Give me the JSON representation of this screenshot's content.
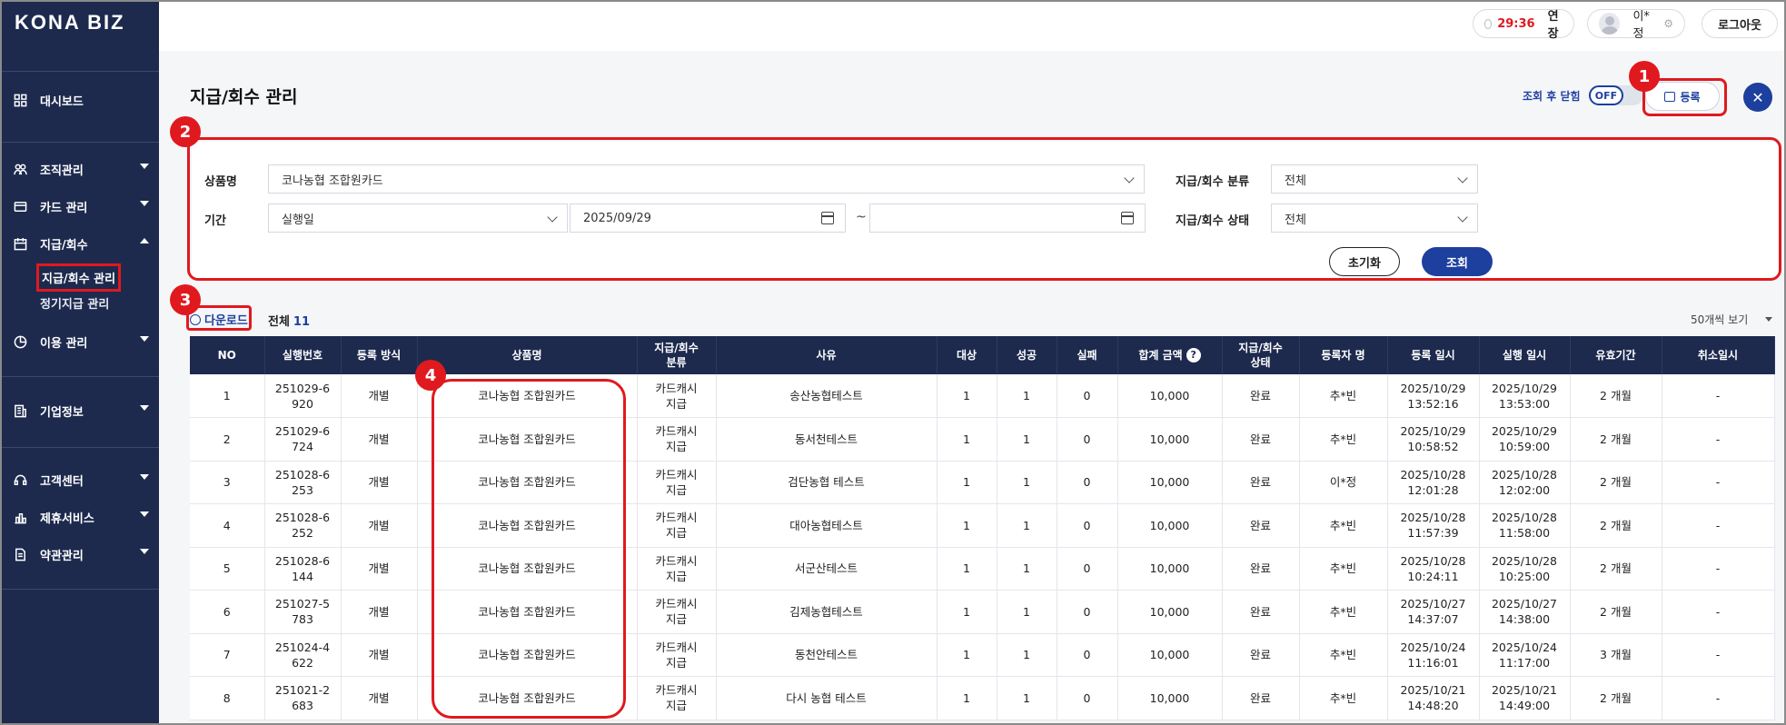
{
  "app": {
    "logo": "KONA BIZ"
  },
  "sidebar": {
    "items": [
      {
        "label": "대시보드",
        "icon": "dashboard-icon"
      },
      {
        "label": "조직관리",
        "icon": "people-icon"
      },
      {
        "label": "카드 관리",
        "icon": "card-icon"
      },
      {
        "label": "지급/회수",
        "icon": "calendar-icon"
      },
      {
        "label": "이용 관리",
        "icon": "pie-icon"
      },
      {
        "label": "기업정보",
        "icon": "building-icon"
      },
      {
        "label": "고객센터",
        "icon": "headset-icon"
      },
      {
        "label": "제휴서비스",
        "icon": "partner-icon"
      },
      {
        "label": "약관관리",
        "icon": "document-icon"
      }
    ],
    "sub": [
      {
        "label": "지급/회수 관리"
      },
      {
        "label": "정기지급 관리"
      }
    ]
  },
  "topbar": {
    "timer": "29:36",
    "extend": "연장",
    "user": "이*정",
    "logout": "로그아웃"
  },
  "page": {
    "title": "지급/회수 관리",
    "close_after_label": "조회 후 닫힘",
    "toggle": "OFF",
    "register": "등록"
  },
  "annotations": [
    "1",
    "2",
    "3",
    "4"
  ],
  "filter": {
    "product_label": "상품명",
    "product_value": "코나농협 조합원카드",
    "category_label": "지급/회수 분류",
    "category_value": "전체",
    "period_label": "기간",
    "period_type": "실행일",
    "date_from": "2025/09/29",
    "date_to": "",
    "tilde": "~",
    "status_label": "지급/회수 상태",
    "status_value": "전체",
    "reset": "초기화",
    "search": "조회"
  },
  "list": {
    "download": "다운로드",
    "total_label": "전체",
    "total_count": "11",
    "per_page": "50개씩 보기"
  },
  "table": {
    "headers": [
      "NO",
      "실행번호",
      "등록 방식",
      "상품명",
      "지급/회수\n분류",
      "사유",
      "대상",
      "성공",
      "실패",
      "합계 금액",
      "지급/회수\n상태",
      "등록자 명",
      "등록 일시",
      "실행 일시",
      "유효기간",
      "취소일시"
    ],
    "help": "?",
    "rows": [
      [
        "1",
        "251029-6\n920",
        "개별",
        "코나농협 조합원카드",
        "카드캐시\n지급",
        "송산농협테스트",
        "1",
        "1",
        "0",
        "10,000",
        "완료",
        "추*빈",
        "2025/10/29\n13:52:16",
        "2025/10/29\n13:53:00",
        "2 개월",
        "-"
      ],
      [
        "2",
        "251029-6\n724",
        "개별",
        "코나농협 조합원카드",
        "카드캐시\n지급",
        "동서천테스트",
        "1",
        "1",
        "0",
        "10,000",
        "완료",
        "추*빈",
        "2025/10/29\n10:58:52",
        "2025/10/29\n10:59:00",
        "2 개월",
        "-"
      ],
      [
        "3",
        "251028-6\n253",
        "개별",
        "코나농협 조합원카드",
        "카드캐시\n지급",
        "검단농협 테스트",
        "1",
        "1",
        "0",
        "10,000",
        "완료",
        "이*정",
        "2025/10/28\n12:01:28",
        "2025/10/28\n12:02:00",
        "2 개월",
        "-"
      ],
      [
        "4",
        "251028-6\n252",
        "개별",
        "코나농협 조합원카드",
        "카드캐시\n지급",
        "대아농협테스트",
        "1",
        "1",
        "0",
        "10,000",
        "완료",
        "추*빈",
        "2025/10/28\n11:57:39",
        "2025/10/28\n11:58:00",
        "2 개월",
        "-"
      ],
      [
        "5",
        "251028-6\n144",
        "개별",
        "코나농협 조합원카드",
        "카드캐시\n지급",
        "서군산테스트",
        "1",
        "1",
        "0",
        "10,000",
        "완료",
        "추*빈",
        "2025/10/28\n10:24:11",
        "2025/10/28\n10:25:00",
        "2 개월",
        "-"
      ],
      [
        "6",
        "251027-5\n783",
        "개별",
        "코나농협 조합원카드",
        "카드캐시\n지급",
        "김제농협테스트",
        "1",
        "1",
        "0",
        "10,000",
        "완료",
        "추*빈",
        "2025/10/27\n14:37:07",
        "2025/10/27\n14:38:00",
        "2 개월",
        "-"
      ],
      [
        "7",
        "251024-4\n622",
        "개별",
        "코나농협 조합원카드",
        "카드캐시\n지급",
        "동천안테스트",
        "1",
        "1",
        "0",
        "10,000",
        "완료",
        "추*빈",
        "2025/10/24\n11:16:01",
        "2025/10/24\n11:17:00",
        "3 개월",
        "-"
      ],
      [
        "8",
        "251021-2\n683",
        "개별",
        "코나농협 조합원카드",
        "카드캐시\n지급",
        "다시 농협 테스트",
        "1",
        "1",
        "0",
        "10,000",
        "완료",
        "추*빈",
        "2025/10/21\n14:48:20",
        "2025/10/21\n14:49:00",
        "2 개월",
        "-"
      ]
    ]
  }
}
